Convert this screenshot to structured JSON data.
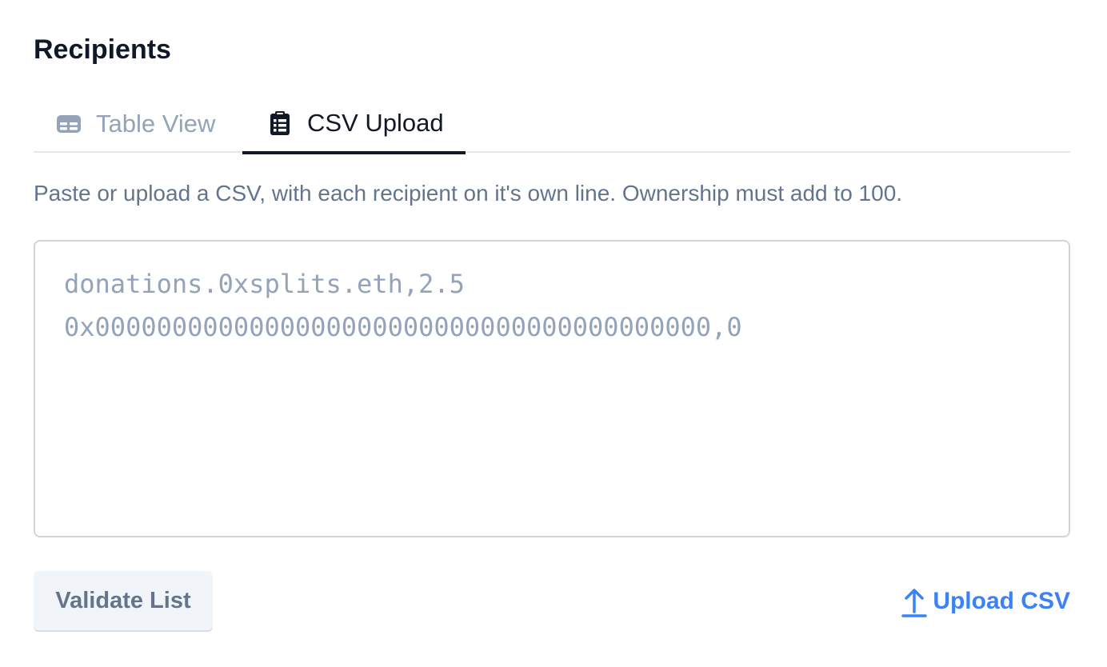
{
  "section": {
    "title": "Recipients"
  },
  "tabs": [
    {
      "label": "Table View",
      "icon": "table-icon",
      "active": false
    },
    {
      "label": "CSV Upload",
      "icon": "clipboard-list-icon",
      "active": true
    }
  ],
  "helper_text": "Paste or upload a CSV, with each recipient on it's own line. Ownership must add to 100.",
  "csv_input": {
    "value": "",
    "placeholder": "donations.0xsplits.eth,2.5\n0x0000000000000000000000000000000000000000,0"
  },
  "actions": {
    "validate_label": "Validate List",
    "upload_label": "Upload CSV",
    "upload_icon": "upload-arrow-icon"
  },
  "colors": {
    "text_primary": "#111827",
    "text_muted": "#64748b",
    "tab_inactive": "#94a3b8",
    "link_blue": "#3b82f6",
    "border": "#d1d5db"
  }
}
